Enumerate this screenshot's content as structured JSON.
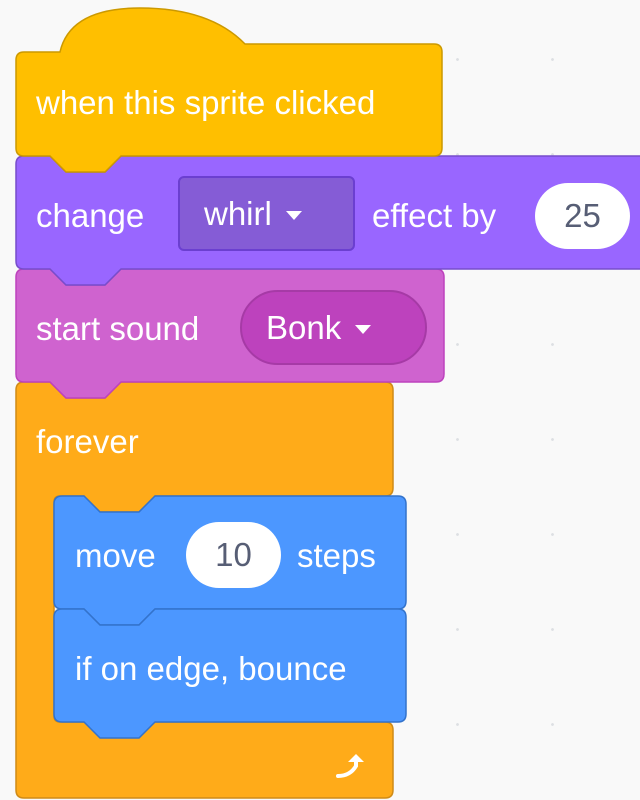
{
  "script": {
    "hat": {
      "label": "when this sprite clicked"
    },
    "looks": {
      "label_prefix": "change",
      "effect_option": "whirl",
      "label_middle": "effect by",
      "amount": "25"
    },
    "sound": {
      "label": "start sound",
      "sound_option": "Bonk"
    },
    "forever": {
      "label": "forever"
    },
    "motion_move": {
      "label_prefix": "move",
      "steps": "10",
      "label_suffix": "steps"
    },
    "motion_bounce": {
      "label": "if on edge, bounce"
    }
  },
  "colors": {
    "events": "#ffbf00",
    "looks": "#9966ff",
    "sound": "#cf63cf",
    "control": "#ffab19",
    "motion": "#4c97ff",
    "canvas": "#f9f9f9"
  },
  "icons": {
    "loop_arrow": "repeat-arrow-icon"
  }
}
